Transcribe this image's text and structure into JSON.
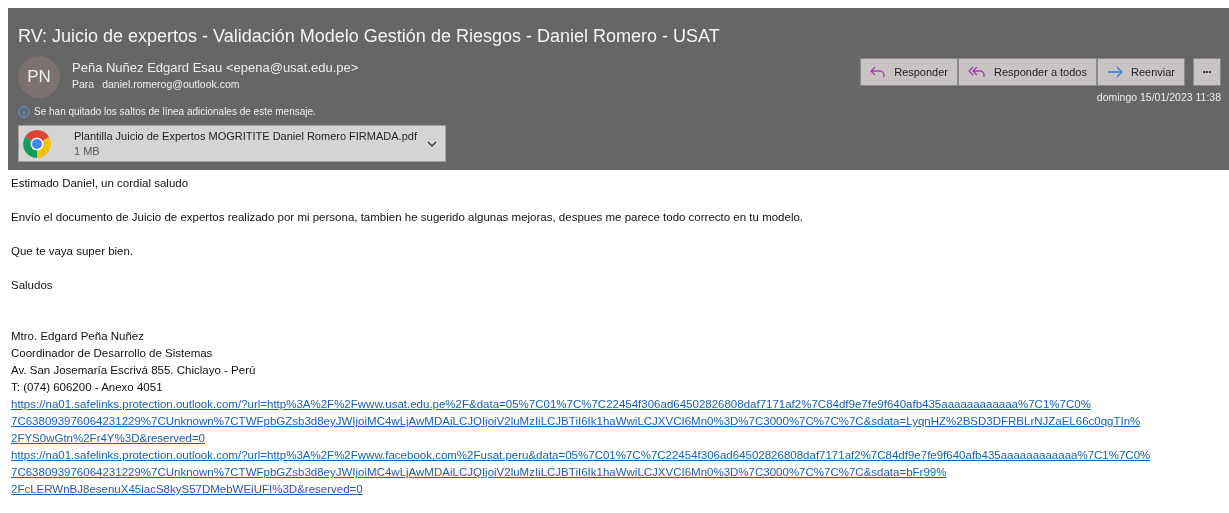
{
  "subject": "RV: Juicio de expertos - Validación Modelo Gestión de Riesgos - Daniel Romero - USAT",
  "sender": {
    "initials": "PN",
    "name": "Peña Nuñez Edgard Esau <epena@usat.edu.pe>",
    "to_label": "Para",
    "to": "daniel.romerog@outlook.com"
  },
  "info": "Se han quitado los saltos de línea adicionales de este mensaje.",
  "attachment": {
    "name": "Plantilla Juicio de Expertos MOGRITITE Daniel Romero FIRMADA.pdf",
    "size": "1 MB"
  },
  "actions": [
    {
      "kind": "reply",
      "label": "Responder"
    },
    {
      "kind": "reply_all",
      "label": "Responder a todos"
    },
    {
      "kind": "forward",
      "label": "Reenviar"
    }
  ],
  "more": "•••",
  "date": "domingo 15/01/2023 11:38",
  "body": [
    "Estimado Daniel, un cordial saludo",
    "Envío el documento de Juicio de expertos realizado por mi persona, tambien he sugerido algunas mejoras, despues me parece todo correcto en tu modelo.",
    "Que te vaya super bien.",
    "Saludos"
  ],
  "signature": [
    "Mtro. Edgard Peña Nuñez",
    "Coordinador de Desarrollo de Sistemas",
    "Av. San Josemaría Escrivá 855. Chiclayo - Perú",
    "T: (074) 606200 - Anexo 4051"
  ],
  "links": [
    [
      "https://na01.safelinks.protection.outlook.com/?url=http%3A%2F%2Fwww.usat.edu.pe%2F&data=05%7C01%7C%7C22454f306ad64502826808daf7171af2%7C84df9e7fe9f640afb435aaaaaaaaaaaa%7C1%7C0%",
      "7C638093976064231229%7CUnknown%7CTWFpbGZsb3d8eyJWIjoiMC4wLjAwMDAiLCJQIjoiV2luMzIiLCJBTiI6Ik1haWwiLCJXVCI6Mn0%3D%7C3000%7C%7C%7C&sdata=LyqnHZ%2BSD3DFRBLrNJZaEL66c0qgTIn%",
      "2FYS0wGtn%2Fr4Y%3D&reserved=0"
    ],
    [
      "https://na01.safelinks.protection.outlook.com/?url=http%3A%2F%2Fwww.facebook.com%2Fusat.peru&data=05%7C01%7C%7C22454f306ad64502826808daf7171af2%7C84df9e7fe9f640afb435aaaaaaaaaaaa%7C1%7C0%",
      "7C638093976064231229%7CUnknown%7CTWFpbGZsb3d8eyJWIjoiMC4wLjAwMDAiLCJQIjoiV2luMzIiLCJBTiI6Ik1haWwiLCJXVCI6Mn0%3D%7C3000%7C%7C%7C&sdata=bFr99%",
      "2FcLERWnBJ8esenuX45iacS8kyS57DMebWEiUFI%3D&reserved=0"
    ]
  ]
}
